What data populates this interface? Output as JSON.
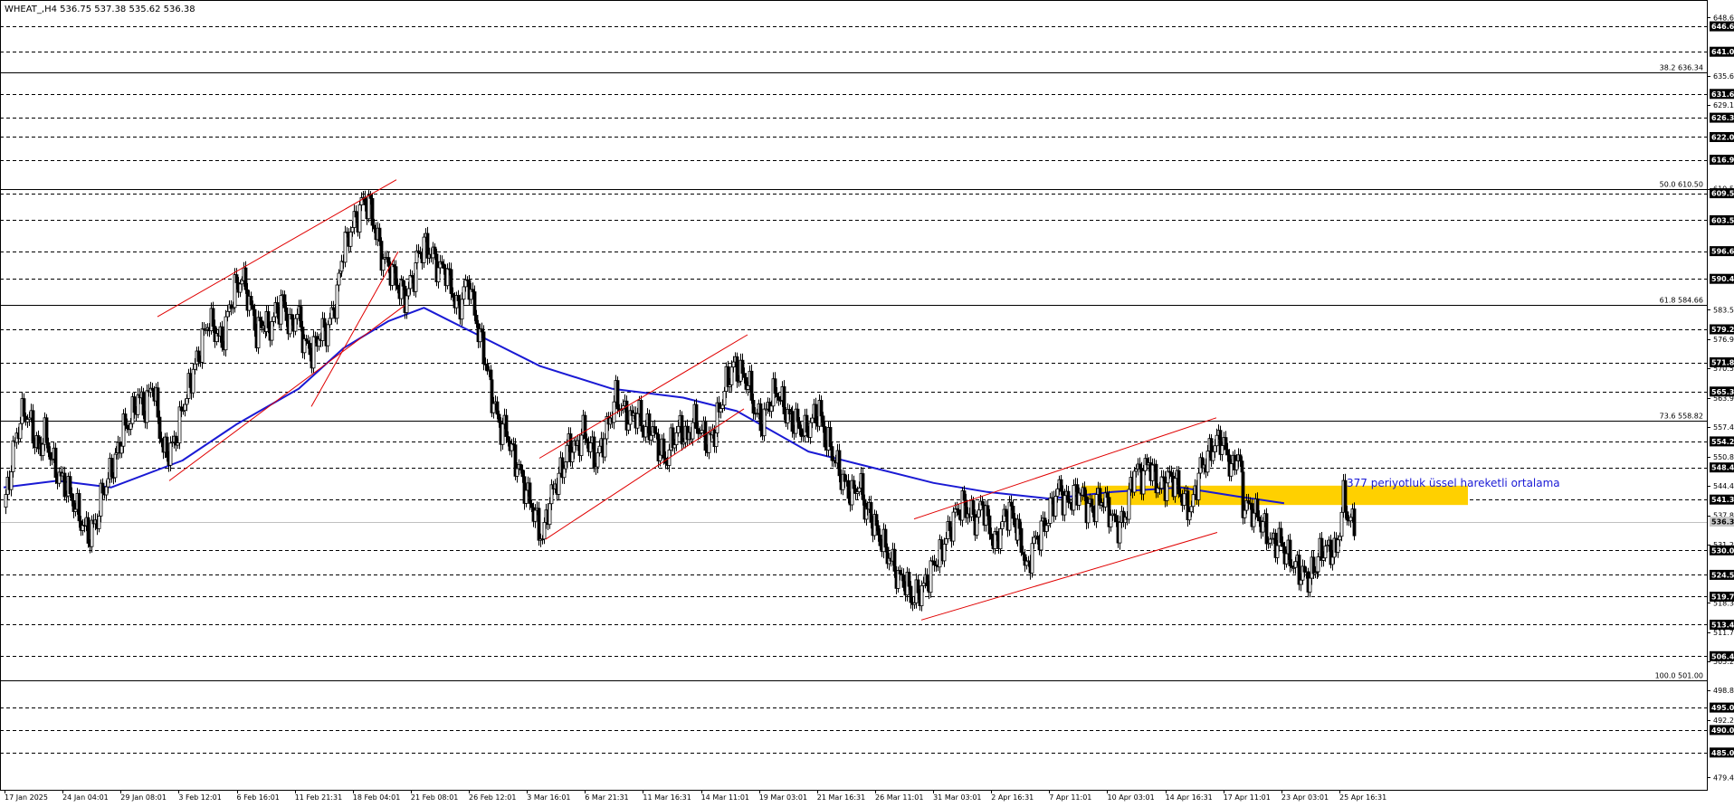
{
  "chart_data": {
    "type": "candlestick",
    "symbol_header": "WHEAT_,H4  536.75 537.38 535.62 536.38",
    "ylim": [
      477.5,
      650.9
    ],
    "price_ticks": [
      648.6,
      635.6,
      629.15,
      610.5,
      583.55,
      576.95,
      570.5,
      563.9,
      557.45,
      550.85,
      544.4,
      537.8,
      531.25,
      518.3,
      511.7,
      505.25,
      498.8,
      492.2,
      479.45
    ],
    "highlighted_levels": [
      646.65,
      641.0,
      631.6,
      626.3,
      622.0,
      616.95,
      609.5,
      603.5,
      596.6,
      590.45,
      579.2,
      571.85,
      565.35,
      554.25,
      548.45,
      541.3,
      530.0,
      524.55,
      519.7,
      513.45,
      506.45,
      495.0,
      490.0,
      485.0
    ],
    "current_price": 536.38,
    "fibonacci_levels": [
      {
        "label": "38.2 636.34",
        "price": 636.34
      },
      {
        "label": "50.0 610.50",
        "price": 610.5
      },
      {
        "label": "61.8 584.66",
        "price": 584.66
      },
      {
        "label": "73.6 558.82",
        "price": 558.82
      },
      {
        "label": "100.0 501.00",
        "price": 501.0
      }
    ],
    "x_labels": [
      "17 Jan 2025",
      "24 Jan 04:01",
      "29 Jan 08:01",
      "3 Feb 12:01",
      "6 Feb 16:01",
      "11 Feb 21:31",
      "18 Feb 04:01",
      "21 Feb 08:01",
      "26 Feb 12:01",
      "3 Mar 16:01",
      "6 Mar 21:31",
      "11 Mar 16:31",
      "14 Mar 11:01",
      "19 Mar 03:01",
      "21 Mar 16:31",
      "26 Mar 11:01",
      "31 Mar 03:01",
      "2 Apr 16:31",
      "7 Apr 11:01",
      "10 Apr 03:01",
      "14 Apr 16:31",
      "17 Apr 11:01",
      "23 Apr 03:01",
      "25 Apr 16:31"
    ],
    "ema_label": "377 periyotluk üssel hareketli ortalama",
    "ema_path": [
      [
        0,
        544.0
      ],
      [
        60,
        545.5
      ],
      [
        120,
        544.0
      ],
      [
        200,
        550.0
      ],
      [
        260,
        558.0
      ],
      [
        330,
        566.0
      ],
      [
        380,
        575.0
      ],
      [
        430,
        581.0
      ],
      [
        470,
        584.0
      ],
      [
        530,
        578.0
      ],
      [
        600,
        571.0
      ],
      [
        680,
        566.0
      ],
      [
        760,
        564.0
      ],
      [
        820,
        561.0
      ],
      [
        900,
        552.0
      ],
      [
        960,
        549.0
      ],
      [
        1040,
        545.0
      ],
      [
        1100,
        543.0
      ],
      [
        1170,
        541.5
      ],
      [
        1240,
        543.0
      ],
      [
        1316,
        544.0
      ],
      [
        1380,
        542.0
      ],
      [
        1432,
        540.5
      ]
    ],
    "channels": [
      {
        "upper": [
          [
            174,
            582.0
          ],
          [
            438,
            612.5
          ]
        ],
        "lower": [
          [
            187,
            545.5
          ],
          [
            447,
            584.5
          ]
        ]
      },
      {
        "upper": [
          [
            596,
            550.5
          ],
          [
            826,
            578.0
          ]
        ],
        "lower": [
          [
            603,
            532.5
          ],
          [
            822,
            561.5
          ]
        ]
      },
      {
        "upper": [
          [
            1010,
            537.0
          ],
          [
            1344,
            559.5
          ]
        ],
        "lower": [
          [
            1018,
            514.5
          ],
          [
            1345,
            534.0
          ]
        ]
      }
    ],
    "inner_channel_lines": [
      {
        "from": [
          344,
          562.0
        ],
        "to": [
          440,
          596.5
        ]
      }
    ],
    "resistance_zone": {
      "from_x": 1195,
      "to_x": 1622,
      "price_low": 540.1,
      "price_high": 544.4
    },
    "ohlc_path": [
      [
        0,
        538.0
      ],
      [
        8,
        548.0
      ],
      [
        14,
        555.0
      ],
      [
        22,
        560.0
      ],
      [
        30,
        557.0
      ],
      [
        38,
        551.0
      ],
      [
        46,
        555.0
      ],
      [
        55,
        549.0
      ],
      [
        62,
        546.0
      ],
      [
        70,
        544.0
      ],
      [
        80,
        540.0
      ],
      [
        88,
        536.0
      ],
      [
        96,
        534.0
      ],
      [
        104,
        538.0
      ],
      [
        110,
        544.0
      ],
      [
        118,
        548.0
      ],
      [
        126,
        552.0
      ],
      [
        134,
        558.0
      ],
      [
        142,
        560.0
      ],
      [
        150,
        565.0
      ],
      [
        158,
        562.0
      ],
      [
        166,
        568.0
      ],
      [
        172,
        560.0
      ],
      [
        178,
        552.0
      ],
      [
        186,
        552.0
      ],
      [
        194,
        556.0
      ],
      [
        200,
        562.0
      ],
      [
        208,
        566.0
      ],
      [
        214,
        570.0
      ],
      [
        220,
        574.0
      ],
      [
        228,
        580.0
      ],
      [
        236,
        578.0
      ],
      [
        244,
        575.0
      ],
      [
        252,
        583.0
      ],
      [
        258,
        587.0
      ],
      [
        266,
        590.0
      ],
      [
        274,
        585.0
      ],
      [
        282,
        578.0
      ],
      [
        290,
        581.0
      ],
      [
        296,
        579.0
      ],
      [
        304,
        583.0
      ],
      [
        312,
        586.0
      ],
      [
        320,
        580.0
      ],
      [
        328,
        584.0
      ],
      [
        336,
        577.0
      ],
      [
        344,
        575.0
      ],
      [
        352,
        579.0
      ],
      [
        360,
        580.0
      ],
      [
        366,
        583.0
      ],
      [
        372,
        588.0
      ],
      [
        378,
        596.0
      ],
      [
        386,
        601.0
      ],
      [
        394,
        604.0
      ],
      [
        402,
        608.0
      ],
      [
        410,
        606.0
      ],
      [
        416,
        600.0
      ],
      [
        424,
        594.0
      ],
      [
        432,
        592.0
      ],
      [
        440,
        588.0
      ],
      [
        448,
        585.0
      ],
      [
        456,
        589.0
      ],
      [
        464,
        595.0
      ],
      [
        472,
        597.0
      ],
      [
        478,
        595.0
      ],
      [
        486,
        592.0
      ],
      [
        494,
        592.0
      ],
      [
        500,
        588.0
      ],
      [
        508,
        583.0
      ],
      [
        514,
        588.0
      ],
      [
        520,
        590.0
      ],
      [
        526,
        583.0
      ],
      [
        532,
        578.0
      ],
      [
        538,
        573.0
      ],
      [
        544,
        567.0
      ],
      [
        550,
        562.0
      ],
      [
        556,
        558.0
      ],
      [
        562,
        558.0
      ],
      [
        568,
        553.0
      ],
      [
        576,
        549.0
      ],
      [
        584,
        544.0
      ],
      [
        590,
        541.0
      ],
      [
        596,
        537.0
      ],
      [
        602,
        533.0
      ],
      [
        608,
        540.0
      ],
      [
        616,
        545.0
      ],
      [
        624,
        548.0
      ],
      [
        632,
        553.0
      ],
      [
        640,
        552.0
      ],
      [
        648,
        556.0
      ],
      [
        656,
        552.0
      ],
      [
        662,
        549.0
      ],
      [
        668,
        552.0
      ],
      [
        676,
        557.0
      ],
      [
        684,
        563.0
      ],
      [
        692,
        560.0
      ],
      [
        700,
        558.0
      ],
      [
        708,
        560.0
      ],
      [
        716,
        556.0
      ],
      [
        724,
        557.0
      ],
      [
        732,
        553.0
      ],
      [
        740,
        550.0
      ],
      [
        748,
        555.0
      ],
      [
        756,
        558.0
      ],
      [
        764,
        555.0
      ],
      [
        770,
        560.0
      ],
      [
        778,
        558.0
      ],
      [
        786,
        555.0
      ],
      [
        794,
        557.0
      ],
      [
        800,
        562.0
      ],
      [
        808,
        568.0
      ],
      [
        816,
        572.0
      ],
      [
        824,
        570.0
      ],
      [
        832,
        568.0
      ],
      [
        840,
        561.0
      ],
      [
        848,
        558.0
      ],
      [
        856,
        563.0
      ],
      [
        864,
        565.0
      ],
      [
        872,
        561.0
      ],
      [
        880,
        558.0
      ],
      [
        888,
        557.0
      ],
      [
        896,
        555.0
      ],
      [
        904,
        558.0
      ],
      [
        912,
        560.0
      ],
      [
        918,
        554.0
      ],
      [
        924,
        552.0
      ],
      [
        932,
        548.0
      ],
      [
        940,
        544.0
      ],
      [
        948,
        542.0
      ],
      [
        956,
        545.0
      ],
      [
        962,
        540.0
      ],
      [
        970,
        538.0
      ],
      [
        978,
        534.0
      ],
      [
        986,
        531.0
      ],
      [
        994,
        528.0
      ],
      [
        1000,
        525.0
      ],
      [
        1008,
        524.0
      ],
      [
        1016,
        520.0
      ],
      [
        1024,
        522.0
      ],
      [
        1032,
        524.0
      ],
      [
        1040,
        528.0
      ],
      [
        1048,
        530.0
      ],
      [
        1056,
        534.0
      ],
      [
        1064,
        538.0
      ],
      [
        1072,
        540.0
      ],
      [
        1080,
        538.0
      ],
      [
        1088,
        536.0
      ],
      [
        1094,
        540.0
      ],
      [
        1100,
        535.0
      ],
      [
        1108,
        530.0
      ],
      [
        1116,
        535.0
      ],
      [
        1124,
        538.0
      ],
      [
        1130,
        535.0
      ],
      [
        1138,
        531.0
      ],
      [
        1144,
        524.0
      ],
      [
        1150,
        530.0
      ],
      [
        1158,
        533.0
      ],
      [
        1166,
        536.0
      ],
      [
        1172,
        540.0
      ],
      [
        1180,
        544.0
      ],
      [
        1186,
        541.0
      ],
      [
        1194,
        542.0
      ],
      [
        1202,
        544.0
      ],
      [
        1210,
        541.0
      ],
      [
        1218,
        540.0
      ],
      [
        1226,
        543.0
      ],
      [
        1234,
        541.0
      ],
      [
        1240,
        538.0
      ],
      [
        1248,
        536.0
      ],
      [
        1256,
        540.0
      ],
      [
        1264,
        549.0
      ],
      [
        1272,
        547.0
      ],
      [
        1280,
        550.0
      ],
      [
        1288,
        545.0
      ],
      [
        1296,
        544.0
      ],
      [
        1304,
        546.0
      ],
      [
        1312,
        544.0
      ],
      [
        1320,
        540.0
      ],
      [
        1328,
        538.0
      ],
      [
        1336,
        546.0
      ],
      [
        1344,
        549.0
      ],
      [
        1352,
        552.0
      ],
      [
        1360,
        554.0
      ],
      [
        1368,
        550.0
      ],
      [
        1374,
        547.0
      ],
      [
        1380,
        552.0
      ],
      [
        1386,
        540.0
      ],
      [
        1394,
        539.0
      ],
      [
        1402,
        538.0
      ],
      [
        1410,
        535.0
      ],
      [
        1418,
        532.0
      ],
      [
        1426,
        533.0
      ],
      [
        1434,
        530.0
      ],
      [
        1442,
        528.0
      ],
      [
        1450,
        526.0
      ],
      [
        1458,
        525.0
      ],
      [
        1466,
        527.0
      ],
      [
        1474,
        531.0
      ],
      [
        1482,
        531.0
      ],
      [
        1490,
        530.0
      ],
      [
        1498,
        542.0
      ],
      [
        1504,
        537.0
      ],
      [
        1510,
        536.0
      ]
    ]
  }
}
